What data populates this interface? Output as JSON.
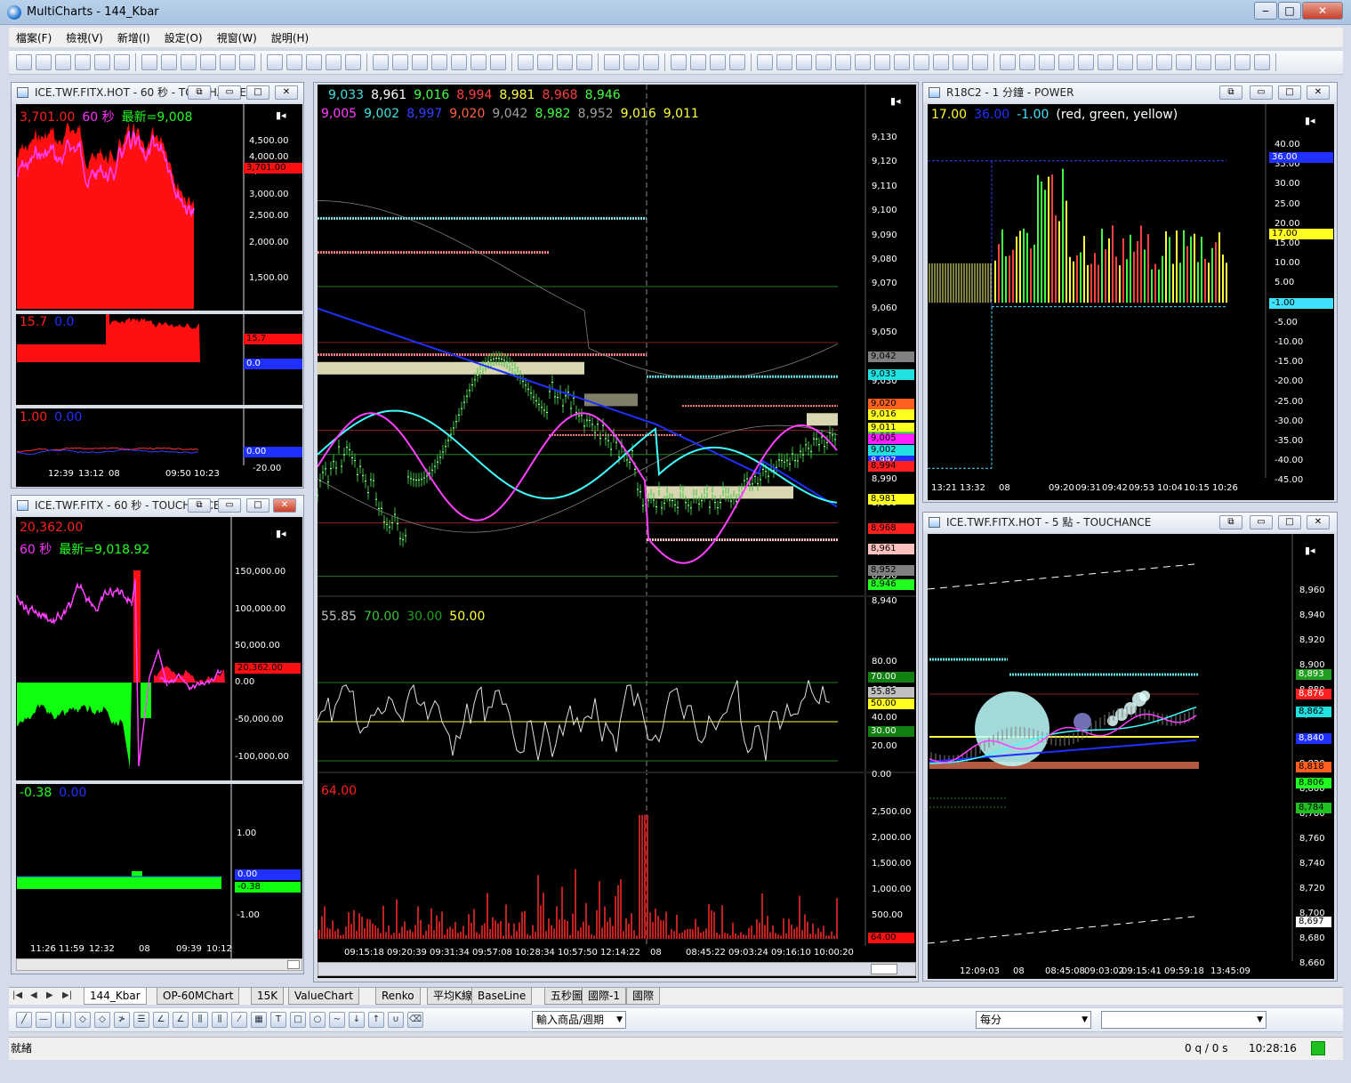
{
  "app": {
    "title": "MultiCharts - 144_Kbar"
  },
  "menu": [
    "檔案(F)",
    "檢視(V)",
    "新增(I)",
    "設定(O)",
    "視窗(W)",
    "說明(H)"
  ],
  "panes": {
    "tl": {
      "title": "ICE.TWF.FITX.HOT - 60 秒 - TOUCHANCE",
      "p1": {
        "legend": [
          [
            "3,701.00",
            "#ff2020"
          ],
          [
            "60 秒",
            "#ff30ff"
          ],
          [
            "最新=9,008",
            "#20ff20"
          ]
        ],
        "ticks": [
          "4,500.00",
          "4,000.00",
          "3,500.00",
          "3,000.00",
          "2,500.00",
          "2,000.00",
          "1,500.00"
        ],
        "tag": "3,701.00"
      },
      "p2": {
        "legend": [
          [
            "15.7",
            "#ff2020"
          ],
          [
            "0.0",
            "#2030ff"
          ]
        ],
        "tags": [
          "15.7",
          "0.0"
        ]
      },
      "p3": {
        "legend": [
          [
            "1.00",
            "#ff2020"
          ],
          [
            "0.00",
            "#2030ff"
          ]
        ],
        "tags": [
          "0.00"
        ],
        "ticks": [
          "-20.00"
        ]
      },
      "xaxis": [
        "12:39",
        "13:12",
        "08",
        "09:50",
        "10:23"
      ]
    },
    "bl": {
      "title": "ICE.TWF.FITX - 60 秒 - TOUCHANCE",
      "p1": {
        "legend1": [
          [
            "20,362.00",
            "#ff2020"
          ]
        ],
        "legend2": [
          [
            "60 秒",
            "#ff30ff"
          ],
          [
            "最新=9,018.92",
            "#20ff20"
          ]
        ],
        "ticks": [
          "150,000.00",
          "100,000.00",
          "50,000.00",
          "0.00",
          "-50,000.00",
          "-100,000.00"
        ],
        "tag": "20,362.00"
      },
      "p2": {
        "legend": [
          [
            "-0.38",
            "#20ff20"
          ],
          [
            "0.00",
            "#2030ff"
          ]
        ],
        "ticks": [
          "1.00",
          "-1.00"
        ],
        "tags": [
          "0.00",
          "-0.38"
        ]
      },
      "xaxis": [
        "11:26",
        "11:59",
        "12:32",
        "08",
        "09:39",
        "10:12"
      ]
    },
    "center": {
      "legend1": [
        [
          "9,033",
          "#40e0e0"
        ],
        [
          "8,961",
          "#ffffff"
        ],
        [
          "9,016",
          "#40ff40"
        ],
        [
          "8,994",
          "#ff4040"
        ],
        [
          "8,981",
          "#ffff40"
        ],
        [
          "8,968",
          "#ff4040"
        ],
        [
          "8,946",
          "#40ff40"
        ]
      ],
      "legend2": [
        [
          "9,005",
          "#ff40ff"
        ],
        [
          "9,002",
          "#40e0e0"
        ],
        [
          "8,997",
          "#3040ff"
        ],
        [
          "9,020",
          "#ff6040"
        ],
        [
          "9,042",
          "#a0a0a0"
        ],
        [
          "8,982",
          "#40ff40"
        ],
        [
          "8,952",
          "#a0a0a0"
        ],
        [
          "9,016",
          "#ffff40"
        ],
        [
          "9,011",
          "#ffff40"
        ]
      ],
      "ticks": [
        "9,130",
        "9,120",
        "9,110",
        "9,100",
        "9,090",
        "9,080",
        "9,070",
        "9,060",
        "9,050",
        "9,040",
        "9,030",
        "9,020",
        "9,010",
        "9,000",
        "8,990",
        "8,980",
        "8,970",
        "8,960",
        "8,950",
        "8,940"
      ],
      "tags": [
        [
          "9,042",
          "#808080",
          "#000"
        ],
        [
          "9,033",
          "#20e0e0",
          "#000"
        ],
        [
          "9,020",
          "#ff6020",
          "#000"
        ],
        [
          "9,016",
          "#ffff20",
          "#000"
        ],
        [
          "9,011",
          "#ffff20",
          "#000"
        ],
        [
          "9,008",
          "#20ff20",
          "#000"
        ],
        [
          "9,005",
          "#ff20ff",
          "#000"
        ],
        [
          "9,002",
          "#20e0e0",
          "#000"
        ],
        [
          "8,997",
          "#2030ff",
          "#fff"
        ],
        [
          "8,994",
          "#ff2020",
          "#000"
        ],
        [
          "8,981",
          "#ffff20",
          "#000"
        ],
        [
          "8,968",
          "#ff2020",
          "#000"
        ],
        [
          "8,961",
          "#ffc0c0",
          "#000"
        ],
        [
          "8,952",
          "#808080",
          "#000"
        ],
        [
          "8,946",
          "#20ff20",
          "#000"
        ]
      ],
      "rsi_legend": [
        [
          "55.85",
          "#c0c0c0"
        ],
        [
          "70.00",
          "#40c040"
        ],
        [
          "30.00",
          "#20a020"
        ],
        [
          "50.00",
          "#ffff40"
        ]
      ],
      "rsi_ticks": [
        "80.00",
        "70.00",
        "60.00",
        "50.00",
        "40.00",
        "30.00",
        "20.00",
        "0.00"
      ],
      "rsi_tags": [
        [
          "70.00",
          "#108010",
          "#fff"
        ],
        [
          "55.85",
          "#c0c0c0",
          "#000"
        ],
        [
          "50.00",
          "#ffff20",
          "#000"
        ],
        [
          "30.00",
          "#108010",
          "#fff"
        ]
      ],
      "vol_legend": [
        [
          "64.00",
          "#ff2020"
        ]
      ],
      "vol_ticks": [
        "2,500.00",
        "2,000.00",
        "1,500.00",
        "1,000.00",
        "500.00"
      ],
      "vol_tag": "64.00",
      "xaxis": [
        "09:15:18",
        "09:20:39",
        "09:31:34",
        "09:57:08",
        "10:28:34",
        "10:57:50",
        "12:14:22",
        "08",
        "08:45:22",
        "09:03:24",
        "09:16:10",
        "10:00:20"
      ]
    },
    "tr": {
      "title": "R18C2 - 1 分鐘 - POWER",
      "legend": [
        [
          "17.00",
          "#ffff20"
        ],
        [
          "36.00",
          "#2030ff"
        ],
        [
          "-1.00",
          "#40e0ff"
        ],
        [
          "(red,  green,  yellow)",
          "#ffffff"
        ]
      ],
      "ticks": [
        "40.00",
        "35.00",
        "30.00",
        "25.00",
        "20.00",
        "15.00",
        "10.00",
        "5.00",
        "0.00",
        "-5.00",
        "-10.00",
        "-15.00",
        "-20.00",
        "-25.00",
        "-30.00",
        "-35.00",
        "-40.00",
        "-45.00"
      ],
      "tags": [
        [
          "36.00",
          "#2030ff",
          "#fff"
        ],
        [
          "17.00",
          "#ffff20",
          "#000"
        ],
        [
          "-1.00",
          "#40e0ff",
          "#000"
        ]
      ],
      "xaxis": [
        "13:21",
        "13:32",
        "08",
        "09:20",
        "09:31",
        "09:42",
        "09:53",
        "10:04",
        "10:15",
        "10:26"
      ]
    },
    "br": {
      "title": "ICE.TWF.FITX.HOT - 5 點 - TOUCHANCE",
      "ticks": [
        "8,960",
        "8,940",
        "8,920",
        "8,900",
        "8,880",
        "8,860",
        "8,840",
        "8,820",
        "8,800",
        "8,780",
        "8,760",
        "8,740",
        "8,720",
        "8,700",
        "8,680",
        "8,660"
      ],
      "tags": [
        [
          "8,893",
          "#20a020",
          "#fff"
        ],
        [
          "8,876",
          "#ff2020",
          "#fff"
        ],
        [
          "8,862",
          "#20e0e0",
          "#000"
        ],
        [
          "8,840",
          "#2030ff",
          "#fff"
        ],
        [
          "8,818",
          "#ff6020",
          "#000"
        ],
        [
          "8,806",
          "#20ff20",
          "#000"
        ],
        [
          "8,784",
          "#20c020",
          "#000"
        ],
        [
          "8,697",
          "#ffffff",
          "#000"
        ]
      ],
      "xaxis": [
        "12:09:03",
        "08",
        "08:45:08",
        "09:03:02",
        "09:15:41",
        "09:59:18",
        "13:45:09"
      ]
    }
  },
  "tabs": [
    "144_Kbar",
    "OP-60MChart",
    "15K",
    "ValueChart",
    "Renko",
    "平均K線",
    "BaseLine",
    "五秒圖",
    "國際-1",
    "國際"
  ],
  "drawbar": {
    "symbol_combo": "輸入商品/週期",
    "period_combo": "每分"
  },
  "status": {
    "left": "就緒",
    "quotes": "0 q / 0 s",
    "time": "10:28:16"
  }
}
